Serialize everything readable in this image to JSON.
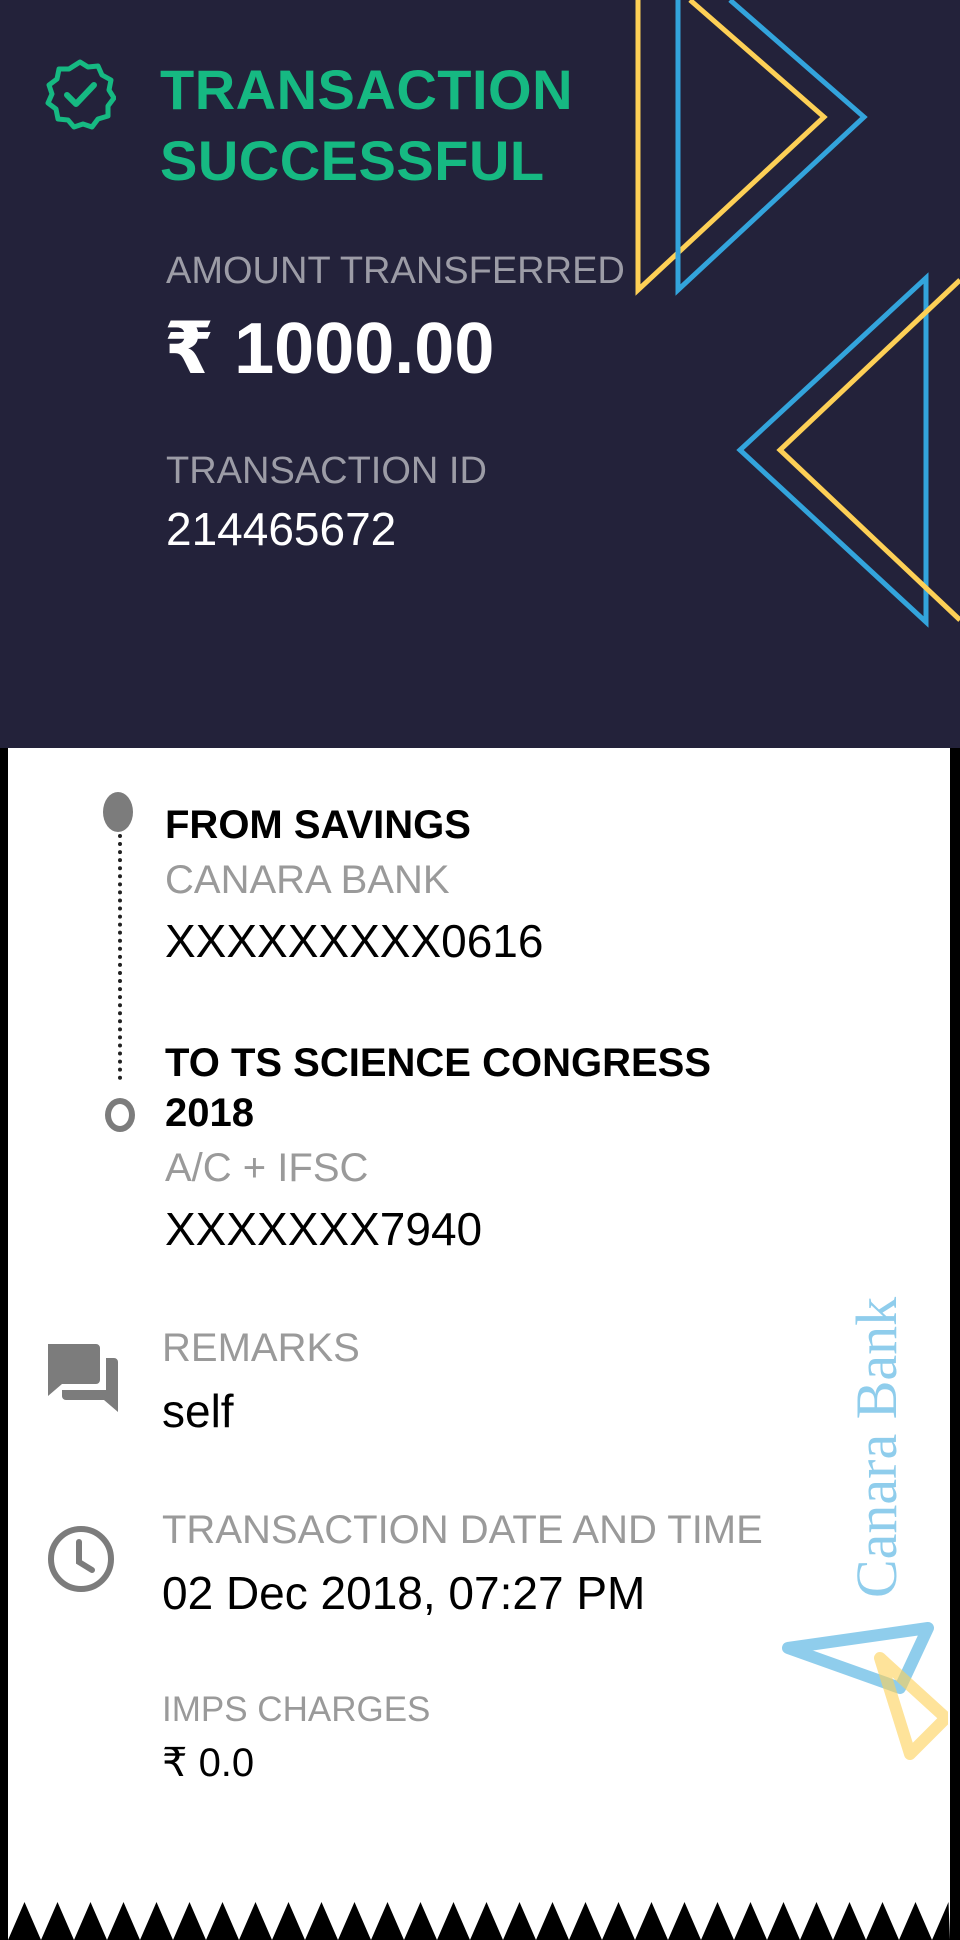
{
  "header": {
    "status_title_line1": "TRANSACTION",
    "status_title_line2": "SUCCESSFUL",
    "amount_label": "AMOUNT TRANSFERRED",
    "amount_value": "₹ 1000.00",
    "transaction_id_label": "TRANSACTION ID",
    "transaction_id_value": "214465672",
    "status_color": "#16b982",
    "background_color": "#23223a"
  },
  "from": {
    "title": "FROM SAVINGS",
    "bank": "CANARA BANK",
    "account": "XXXXXXXXX0616"
  },
  "to": {
    "title_line1": "TO TS SCIENCE CONGRESS",
    "title_line2": "2018",
    "type_label": "A/C + IFSC",
    "account": "XXXXXXX7940"
  },
  "remarks": {
    "label": "REMARKS",
    "value": "self",
    "icon": "chat-icon"
  },
  "datetime": {
    "label": "TRANSACTION DATE AND TIME",
    "value": "02 Dec 2018, 07:27 PM",
    "icon": "clock-icon"
  },
  "charges": {
    "label": "IMPS CHARGES",
    "value": "₹ 0.0"
  },
  "watermark": {
    "text": "Canara Bank",
    "colors": {
      "blue": "#33a4dc",
      "yellow": "#fdd056"
    }
  }
}
